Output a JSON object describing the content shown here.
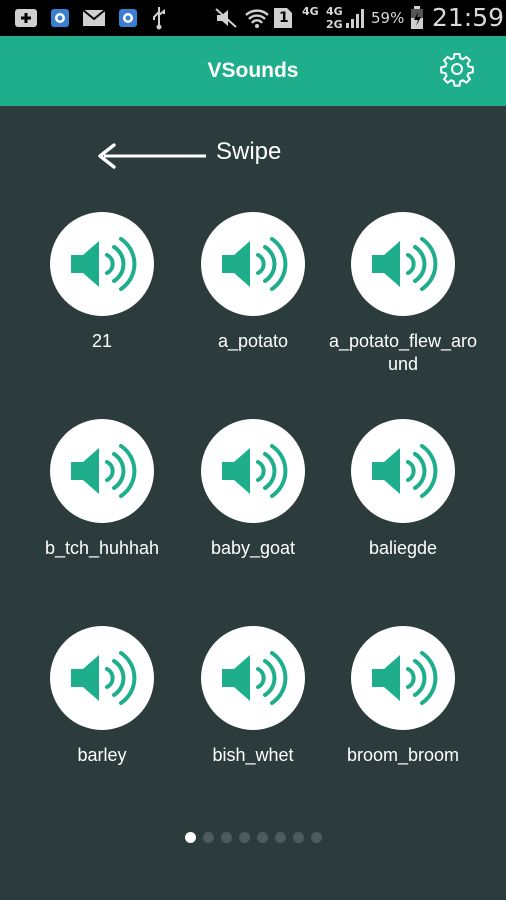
{
  "status_bar": {
    "battery_percent": "59%",
    "time": "21:59",
    "network_1": "4G",
    "network_2": "4G",
    "network_3": "2G",
    "sim_slot": "1",
    "icons": [
      "add-box-icon",
      "app-icon",
      "mail-icon",
      "app-icon",
      "usb-icon",
      "mute-icon",
      "wifi-icon",
      "sim-icon",
      "signal-icon",
      "battery-charging-icon"
    ]
  },
  "app_bar": {
    "title": "VSounds",
    "settings_icon": "gear-icon"
  },
  "swipe_hint": {
    "label": "Swipe",
    "icon": "arrow-left-icon"
  },
  "sounds": [
    {
      "label": "21"
    },
    {
      "label": "a_potato"
    },
    {
      "label": "a_potato_flew_around"
    },
    {
      "label": "b_tch_huhhah"
    },
    {
      "label": "baby_goat"
    },
    {
      "label": "baliegde"
    },
    {
      "label": "barley"
    },
    {
      "label": "bish_whet"
    },
    {
      "label": "broom_broom"
    }
  ],
  "pager": {
    "total_pages": 8,
    "current_page": 1
  },
  "colors": {
    "accent": "#1fae8c",
    "background": "#2c3b3c",
    "status_bar": "#000000",
    "button": "#ffffff"
  }
}
